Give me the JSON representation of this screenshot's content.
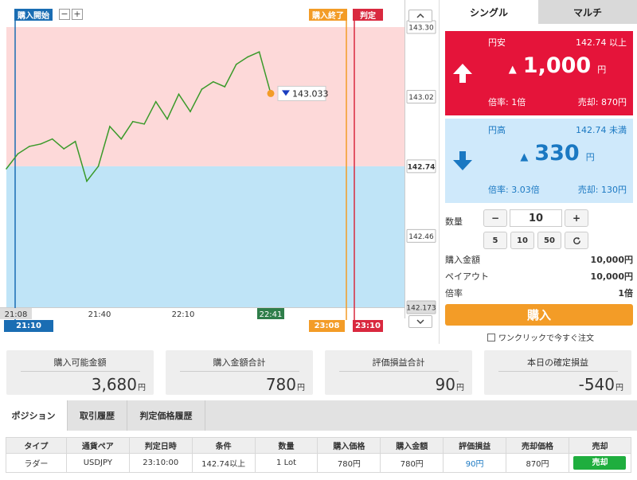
{
  "chart": {
    "start_tag": "購入開始",
    "end_tag": "購入終了",
    "judge_tag": "判定",
    "current_price": "143.033",
    "price_labels": [
      "143.30",
      "143.02",
      "142.74",
      "142.46",
      "142.173"
    ],
    "time_labels": [
      "21:08",
      "21:40",
      "22:10",
      "22:41"
    ],
    "bottom_tags": {
      "start": "21:10",
      "end": "23:08",
      "judge": "23:10"
    },
    "zoom_minus": "−",
    "zoom_plus": "+",
    "scroll_up": "up-chevron-icon",
    "scroll_down": "down-chevron-icon",
    "colors": {
      "upper_zone": "#fdd9d9",
      "lower_zone": "#bfe4f7",
      "line": "#3a9a2a",
      "start": "#1a6db3",
      "end": "#f39c27",
      "judge": "#d9293f"
    }
  },
  "chart_data": {
    "type": "line",
    "title": "",
    "xlabel": "",
    "ylabel": "",
    "x": [
      "21:08",
      "21:12",
      "21:16",
      "21:20",
      "21:24",
      "21:28",
      "21:32",
      "21:36",
      "21:40",
      "21:44",
      "21:48",
      "21:52",
      "21:56",
      "22:00",
      "22:04",
      "22:08",
      "22:12",
      "22:16",
      "22:20",
      "22:24",
      "22:28",
      "22:32",
      "22:36",
      "22:41"
    ],
    "series": [
      {
        "values": [
          142.73,
          142.79,
          142.82,
          142.83,
          142.85,
          142.81,
          142.84,
          142.68,
          142.74,
          142.9,
          142.85,
          142.92,
          142.91,
          143.0,
          142.93,
          143.03,
          142.96,
          143.05,
          143.08,
          143.06,
          143.15,
          143.18,
          143.2,
          143.033
        ]
      }
    ],
    "ylim": [
      142.173,
      143.3
    ],
    "reference_price": 142.74,
    "grid": false
  },
  "panel": {
    "tabs": [
      "シングル",
      "マルチ"
    ],
    "up": {
      "label": "円安",
      "condition": "142.74 以上",
      "price": "1,000",
      "yen": "円",
      "rate": "倍率: 1倍",
      "sell": "売却: 870円",
      "icon": "up-arrow-icon",
      "color": "#e5143a"
    },
    "down": {
      "label": "円高",
      "condition": "142.74 未満",
      "price": "330",
      "yen": "円",
      "rate": "倍率: 3.03倍",
      "sell": "売却: 130円",
      "icon": "down-arrow-icon",
      "color": "#cfe9fb"
    },
    "qty_label": "数量",
    "qty_minus": "−",
    "qty_value": "10",
    "qty_plus": "+",
    "presets": [
      "5",
      "10",
      "50"
    ],
    "reset_icon": "refresh-icon",
    "purchase_amount_label": "購入金額",
    "purchase_amount": "10,000円",
    "payout_label": "ペイアウト",
    "payout": "10,000円",
    "rate_label": "倍率",
    "rate": "1倍",
    "buy_label": "購入",
    "oneclick_label": "ワンクリックで今すぐ注文"
  },
  "summary": [
    {
      "label": "購入可能金額",
      "value": "3,680",
      "unit": "円"
    },
    {
      "label": "購入金額合計",
      "value": "780",
      "unit": "円"
    },
    {
      "label": "評価損益合計",
      "value": "90",
      "unit": "円"
    },
    {
      "label": "本日の確定損益",
      "value": "-540",
      "unit": "円"
    }
  ],
  "bottom_tabs": [
    "ポジション",
    "取引履歴",
    "判定価格履歴"
  ],
  "table": {
    "headers": [
      "タイプ",
      "通貨ペア",
      "判定日時",
      "条件",
      "数量",
      "購入価格",
      "購入金額",
      "評価損益",
      "売却価格",
      "売却"
    ],
    "rows": [
      [
        "ラダー",
        "USDJPY",
        "23:10:00",
        "142.74以上",
        "1 Lot",
        "780円",
        "780円",
        "90円",
        "870円",
        "売却"
      ]
    ]
  }
}
